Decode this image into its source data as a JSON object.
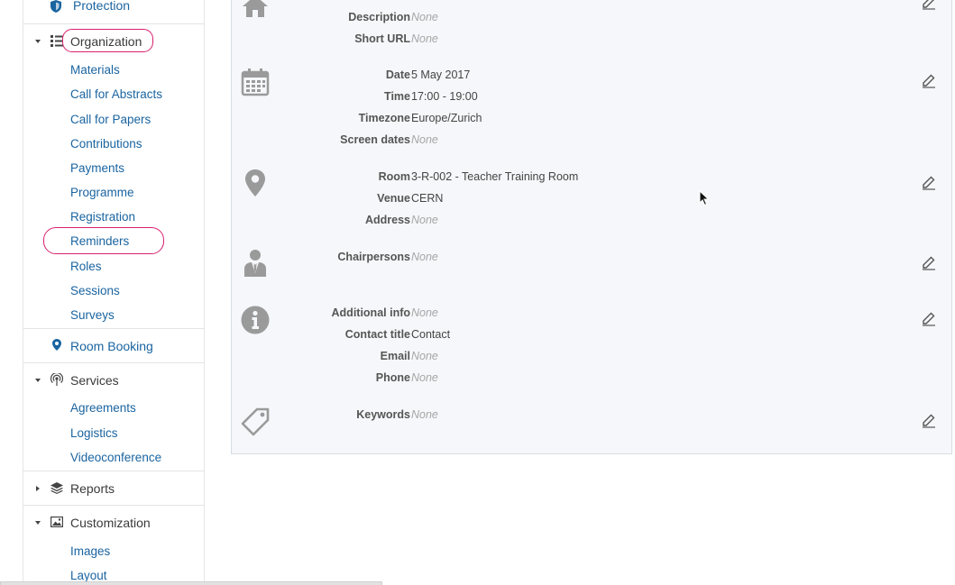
{
  "sidebar": {
    "protection": "Protection",
    "organization": {
      "label": "Organization",
      "items": [
        "Materials",
        "Call for Abstracts",
        "Call for Papers",
        "Contributions",
        "Payments",
        "Programme",
        "Registration",
        "Reminders",
        "Roles",
        "Sessions",
        "Surveys"
      ]
    },
    "room_booking": "Room Booking",
    "services": {
      "label": "Services",
      "items": [
        "Agreements",
        "Logistics",
        "Videoconference"
      ]
    },
    "reports": "Reports",
    "customization": {
      "label": "Customization",
      "items": [
        "Images",
        "Layout"
      ]
    }
  },
  "panels": {
    "general": {
      "icon": "home-icon",
      "fields": [
        {
          "label": "Description",
          "value": "None"
        },
        {
          "label": "Short URL",
          "value": "None"
        }
      ]
    },
    "dates": {
      "icon": "calendar-icon",
      "fields": [
        {
          "label": "Date",
          "value": "5 May 2017"
        },
        {
          "label": "Time",
          "value": "17:00 - 19:00"
        },
        {
          "label": "Timezone",
          "value": "Europe/Zurich"
        },
        {
          "label": "Screen dates",
          "value": "None"
        }
      ]
    },
    "location": {
      "icon": "map-pin-icon",
      "fields": [
        {
          "label": "Room",
          "value": "3-R-002 - Teacher Training Room"
        },
        {
          "label": "Venue",
          "value": "CERN"
        },
        {
          "label": "Address",
          "value": "None"
        }
      ]
    },
    "people": {
      "icon": "person-icon",
      "fields": [
        {
          "label": "Chairpersons",
          "value": "None"
        }
      ]
    },
    "info": {
      "icon": "info-icon",
      "fields": [
        {
          "label": "Additional info",
          "value": "None"
        },
        {
          "label": "Contact title",
          "value": "Contact"
        },
        {
          "label": "Email",
          "value": "None"
        },
        {
          "label": "Phone",
          "value": "None"
        }
      ]
    },
    "keywords": {
      "icon": "tag-icon",
      "fields": [
        {
          "label": "Keywords",
          "value": "None"
        }
      ]
    }
  },
  "colors": {
    "link": "#1a64a0",
    "highlight_ring": "#d6206e",
    "panel_bg": "#f5f7fa",
    "border": "#d7dde3"
  }
}
